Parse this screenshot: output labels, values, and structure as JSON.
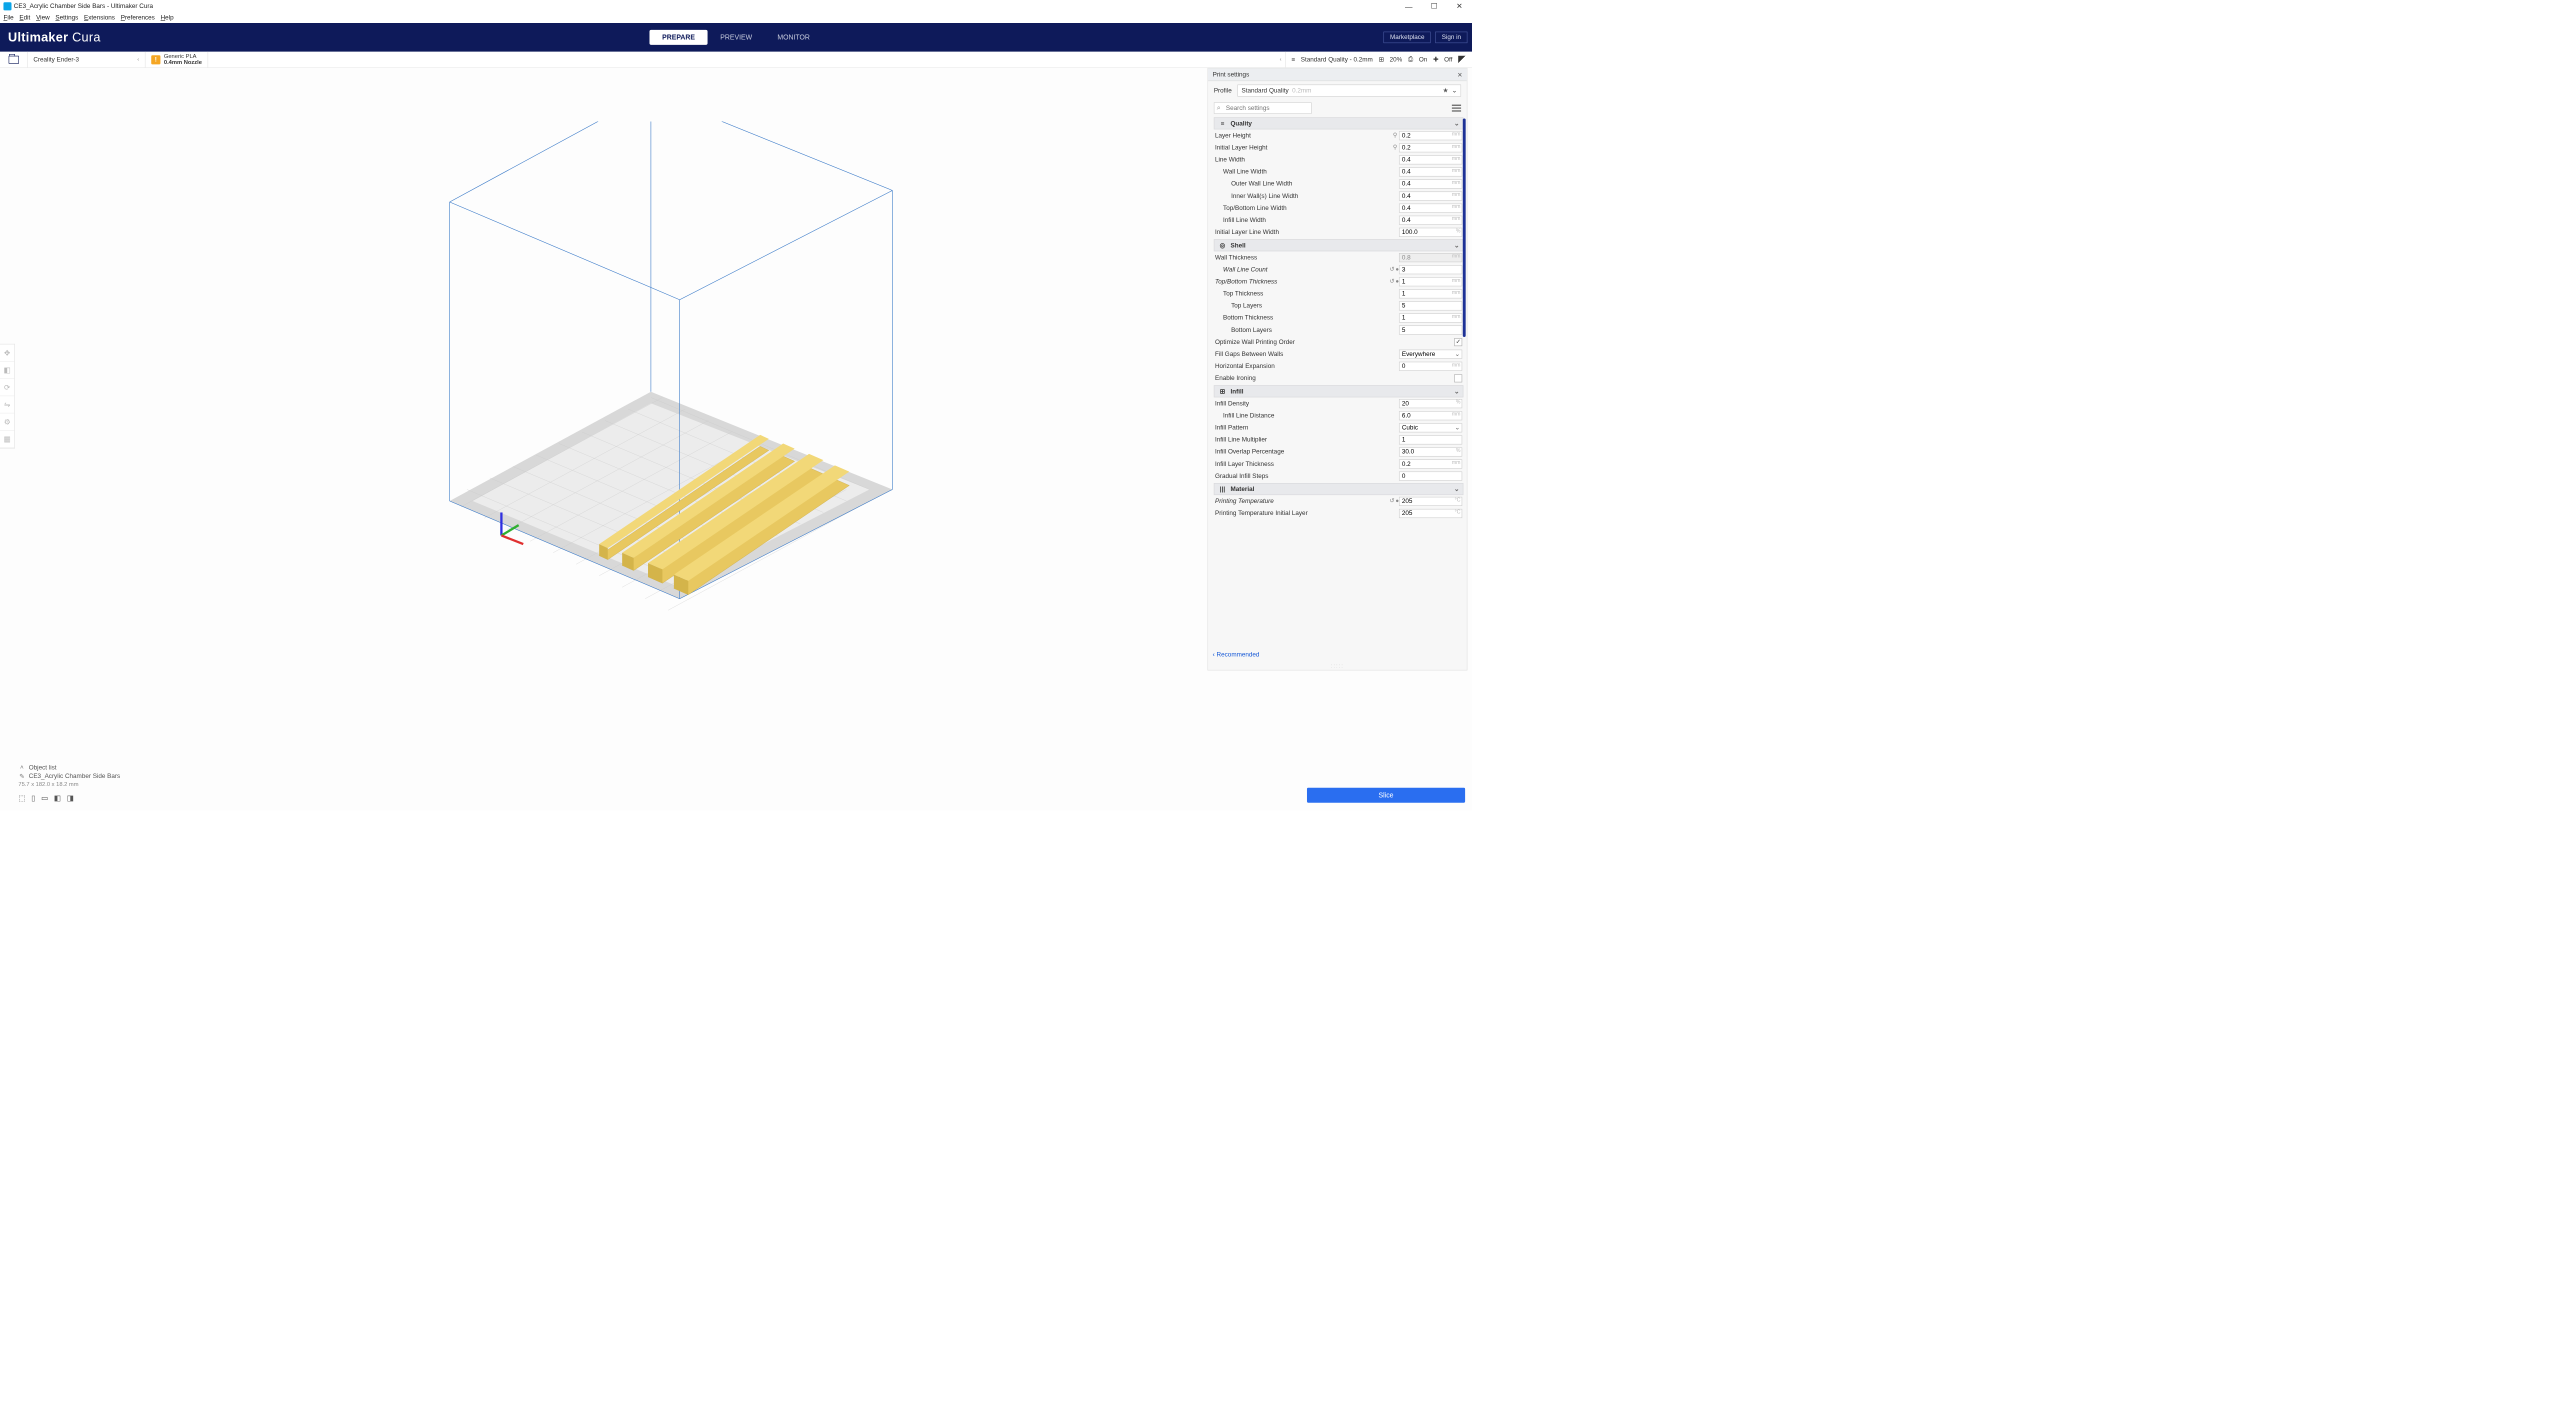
{
  "window": {
    "title": "CE3_Acrylic Chamber Side Bars - Ultimaker Cura"
  },
  "menu": [
    "File",
    "Edit",
    "View",
    "Settings",
    "Extensions",
    "Preferences",
    "Help"
  ],
  "app": {
    "name_bold": "Ultimaker",
    "name_light": "Cura"
  },
  "stages": {
    "prepare": "PREPARE",
    "preview": "PREVIEW",
    "monitor": "MONITOR"
  },
  "topbar_buttons": {
    "marketplace": "Marketplace",
    "signin": "Sign in"
  },
  "printer": {
    "name": "Creality Ender-3"
  },
  "material": {
    "name": "Generic PLA",
    "nozzle": "0.4mm Nozzle"
  },
  "summary": {
    "profile": "Standard Quality - 0.2mm",
    "infill_ico": "⊞",
    "infill": "20%",
    "support_ico": "⎙",
    "support": "On",
    "adhesion_ico": "✚",
    "adhesion": "Off"
  },
  "panel": {
    "title": "Print settings",
    "profile_label": "Profile",
    "profile_value": "Standard Quality",
    "profile_hint": "0.2mm",
    "search_placeholder": "Search settings",
    "recommended": "Recommended"
  },
  "cats": {
    "quality": "Quality",
    "shell": "Shell",
    "infill": "Infill",
    "material": "Material"
  },
  "settings": {
    "layer_height": {
      "label": "Layer Height",
      "val": "0.2",
      "unit": "mm",
      "link": true
    },
    "initial_layer_height": {
      "label": "Initial Layer Height",
      "val": "0.2",
      "unit": "mm",
      "link": true
    },
    "line_width": {
      "label": "Line Width",
      "val": "0.4",
      "unit": "mm"
    },
    "wall_line_width": {
      "label": "Wall Line Width",
      "val": "0.4",
      "unit": "mm"
    },
    "outer_wall_line_width": {
      "label": "Outer Wall Line Width",
      "val": "0.4",
      "unit": "mm"
    },
    "inner_wall_line_width": {
      "label": "Inner Wall(s) Line Width",
      "val": "0.4",
      "unit": "mm"
    },
    "topbottom_line_width": {
      "label": "Top/Bottom Line Width",
      "val": "0.4",
      "unit": "mm"
    },
    "infill_line_width": {
      "label": "Infill Line Width",
      "val": "0.4",
      "unit": "mm"
    },
    "initial_layer_line_width": {
      "label": "Initial Layer Line Width",
      "val": "100.0",
      "unit": "%"
    },
    "wall_thickness": {
      "label": "Wall Thickness",
      "val": "0.8",
      "unit": "mm",
      "readonly": true
    },
    "wall_line_count": {
      "label": "Wall Line Count",
      "val": "3",
      "icons": true
    },
    "topbottom_thickness": {
      "label": "Top/Bottom Thickness",
      "val": "1",
      "unit": "mm",
      "icons": true
    },
    "top_thickness": {
      "label": "Top Thickness",
      "val": "1",
      "unit": "mm"
    },
    "top_layers": {
      "label": "Top Layers",
      "val": "5"
    },
    "bottom_thickness": {
      "label": "Bottom Thickness",
      "val": "1",
      "unit": "mm"
    },
    "bottom_layers": {
      "label": "Bottom Layers",
      "val": "5"
    },
    "optimize_wall_order": {
      "label": "Optimize Wall Printing Order",
      "checked": true
    },
    "fill_gaps": {
      "label": "Fill Gaps Between Walls",
      "val": "Everywhere"
    },
    "horizontal_expansion": {
      "label": "Horizontal Expansion",
      "val": "0",
      "unit": "mm"
    },
    "enable_ironing": {
      "label": "Enable Ironing",
      "checked": false
    },
    "infill_density": {
      "label": "Infill Density",
      "val": "20",
      "unit": "%"
    },
    "infill_line_distance": {
      "label": "Infill Line Distance",
      "val": "6.0",
      "unit": "mm"
    },
    "infill_pattern": {
      "label": "Infill Pattern",
      "val": "Cubic"
    },
    "infill_line_multiplier": {
      "label": "Infill Line Multiplier",
      "val": "1"
    },
    "infill_overlap_pct": {
      "label": "Infill Overlap Percentage",
      "val": "30.0",
      "unit": "%"
    },
    "infill_layer_thickness": {
      "label": "Infill Layer Thickness",
      "val": "0.2",
      "unit": "mm"
    },
    "gradual_infill_steps": {
      "label": "Gradual Infill Steps",
      "val": "0"
    },
    "printing_temp": {
      "label": "Printing Temperature",
      "val": "205",
      "unit": "°C",
      "icons": true
    },
    "printing_temp_initial": {
      "label": "Printing Temperature Initial Layer",
      "val": "205",
      "unit": "°C"
    }
  },
  "object": {
    "list_label": "Object list",
    "name": "CE3_Acrylic Chamber Side Bars",
    "dims": "75.7 x 182.0 x 18.2 mm"
  },
  "slice": "Slice"
}
